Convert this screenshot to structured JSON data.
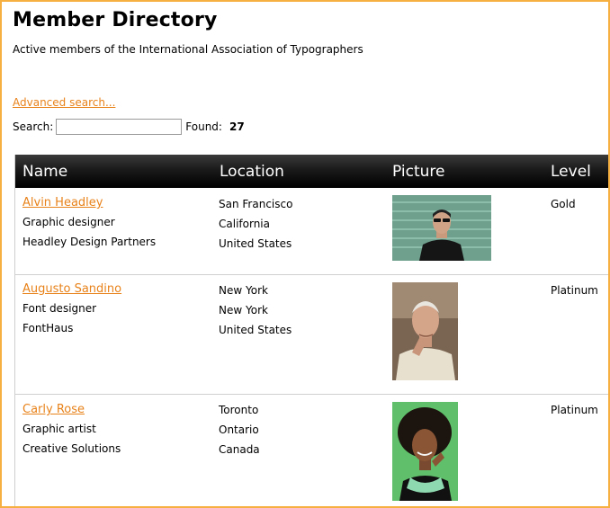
{
  "page": {
    "title": "Member Directory",
    "subtitle": "Active members of the International Association of Typographers"
  },
  "advanced_search_label": "Advanced search...",
  "search": {
    "label": "Search:",
    "value": "",
    "placeholder": ""
  },
  "found": {
    "label": "Found:",
    "count": "27"
  },
  "table": {
    "headers": [
      "Name",
      "Location",
      "Picture",
      "Level"
    ],
    "rows": [
      {
        "name": "Alvin Headley",
        "title": "Graphic designer",
        "company": "Headley Design Partners",
        "city": "San Francisco",
        "region": "California",
        "country": "United States",
        "level": "Gold"
      },
      {
        "name": "Augusto Sandino",
        "title": "Font designer",
        "company": "FontHaus",
        "city": "New York",
        "region": "New York",
        "country": "United States",
        "level": "Platinum"
      },
      {
        "name": "Carly Rose",
        "title": "Graphic artist",
        "company": "Creative Solutions",
        "city": "Toronto",
        "region": "Ontario",
        "country": "Canada",
        "level": "Platinum"
      }
    ]
  },
  "colors": {
    "accent": "#e8821a",
    "border": "#f5b041",
    "header_bg": "#000000"
  }
}
